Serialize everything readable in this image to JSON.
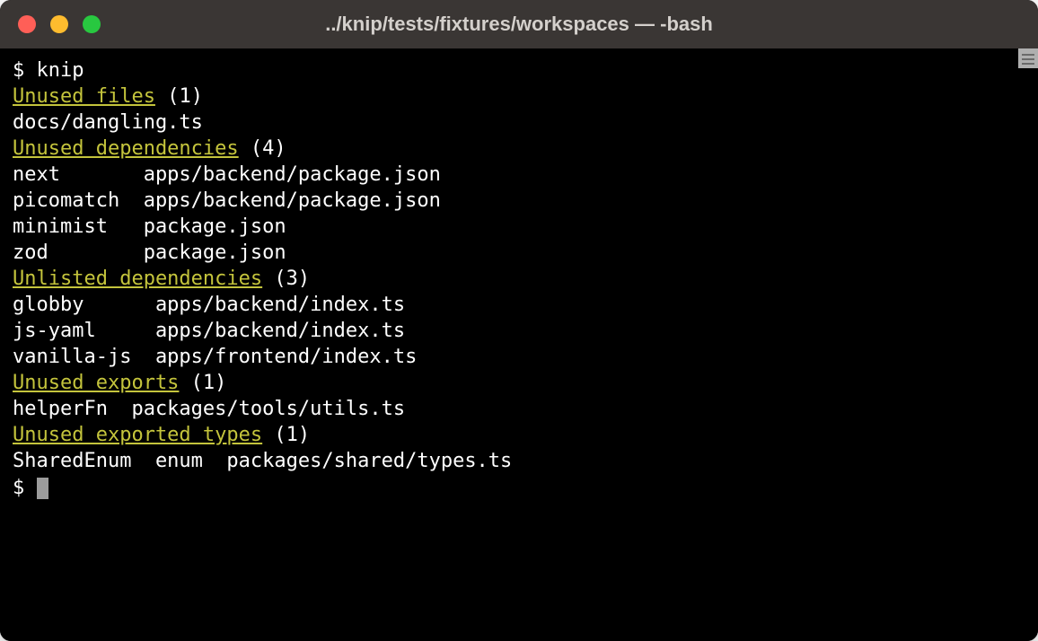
{
  "window": {
    "title": "../knip/tests/fixtures/workspaces — -bash"
  },
  "terminal": {
    "prompt": "$",
    "command": "knip",
    "sections": [
      {
        "header": "Unused files",
        "count": "(1)",
        "rows": [
          {
            "col1": "docs/dangling.ts",
            "col2": "",
            "col3": ""
          }
        ]
      },
      {
        "header": "Unused dependencies",
        "count": "(4)",
        "rows": [
          {
            "col1": "next",
            "col2": "apps/backend/package.json",
            "col3": ""
          },
          {
            "col1": "picomatch",
            "col2": "apps/backend/package.json",
            "col3": ""
          },
          {
            "col1": "minimist",
            "col2": "package.json",
            "col3": ""
          },
          {
            "col1": "zod",
            "col2": "package.json",
            "col3": ""
          }
        ],
        "col1_width": 11
      },
      {
        "header": "Unlisted dependencies",
        "count": "(3)",
        "rows": [
          {
            "col1": "globby",
            "col2": "apps/backend/index.ts",
            "col3": ""
          },
          {
            "col1": "js-yaml",
            "col2": "apps/backend/index.ts",
            "col3": ""
          },
          {
            "col1": "vanilla-js",
            "col2": "apps/frontend/index.ts",
            "col3": ""
          }
        ],
        "col1_width": 12
      },
      {
        "header": "Unused exports",
        "count": "(1)",
        "rows": [
          {
            "col1": "helperFn",
            "col2": "packages/tools/utils.ts",
            "col3": ""
          }
        ],
        "col1_width": 10
      },
      {
        "header": "Unused exported types",
        "count": "(1)",
        "rows": [
          {
            "col1": "SharedEnum",
            "col2": "enum",
            "col3": "packages/shared/types.ts"
          }
        ],
        "col1_width": 12,
        "col2_width": 6
      }
    ]
  }
}
